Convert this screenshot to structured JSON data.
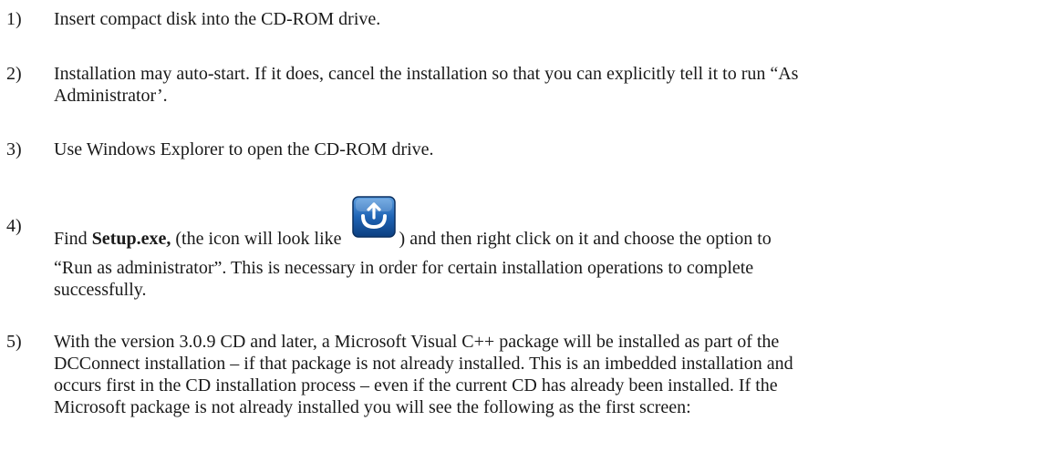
{
  "steps": [
    {
      "number": "1)",
      "lines": [
        "Insert compact disk into the CD-ROM drive."
      ]
    },
    {
      "number": "2)",
      "lines": [
        "Installation may auto-start.  If it does, cancel the installation so that you can explicitly tell it to run “As",
        "Administrator’."
      ]
    },
    {
      "number": "3)",
      "lines": [
        "Use Windows Explorer to open the CD-ROM drive."
      ]
    },
    {
      "number": "4)",
      "line1_a": "Find ",
      "line1_bold": "Setup.exe,",
      "line1_b": " (the icon will look like ",
      "line1_c": ") and then right click on it and choose the option to",
      "icon": "setup-icon",
      "icon_color": "#1d5fa8",
      "lines_rest": [
        "“Run as administrator”.   This is necessary in order for certain installation operations to complete",
        "successfully."
      ]
    },
    {
      "number": "5)",
      "lines": [
        "With the version 3.0.9 CD and later, a Microsoft Visual C++ package will be installed as part of the",
        "DCConnect installation – if that package is not already installed.  This is an imbedded installation and",
        "occurs first in the CD installation process – even if the current CD has already been installed.  If the",
        "Microsoft package is not already installed you will see the following as the first screen:"
      ]
    }
  ]
}
